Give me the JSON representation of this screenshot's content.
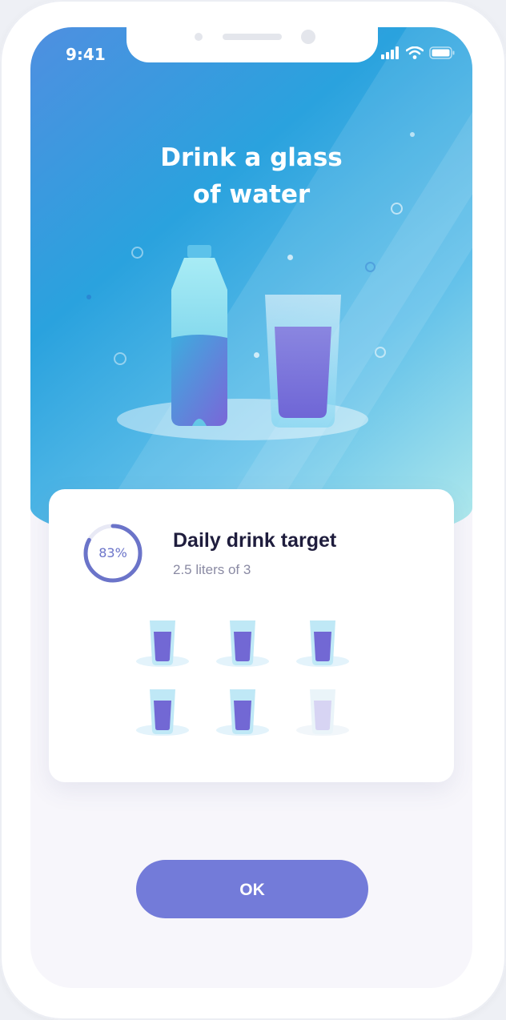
{
  "status_bar": {
    "time": "9:41"
  },
  "hero": {
    "title_line1": "Drink a glass",
    "title_line2": "of water"
  },
  "daily_target": {
    "progress_label": "83%",
    "progress_fraction": 0.83,
    "title": "Daily drink target",
    "subtitle": "2.5 liters of 3",
    "glasses": [
      {
        "filled": true
      },
      {
        "filled": true
      },
      {
        "filled": true
      },
      {
        "filled": true
      },
      {
        "filled": true
      },
      {
        "filled": false
      }
    ]
  },
  "ok_button": {
    "label": "OK"
  },
  "colors": {
    "accent": "#737bd9",
    "ring": "#6b74c9",
    "hero_start": "#4f8fe0",
    "hero_end": "#b6ecec"
  }
}
